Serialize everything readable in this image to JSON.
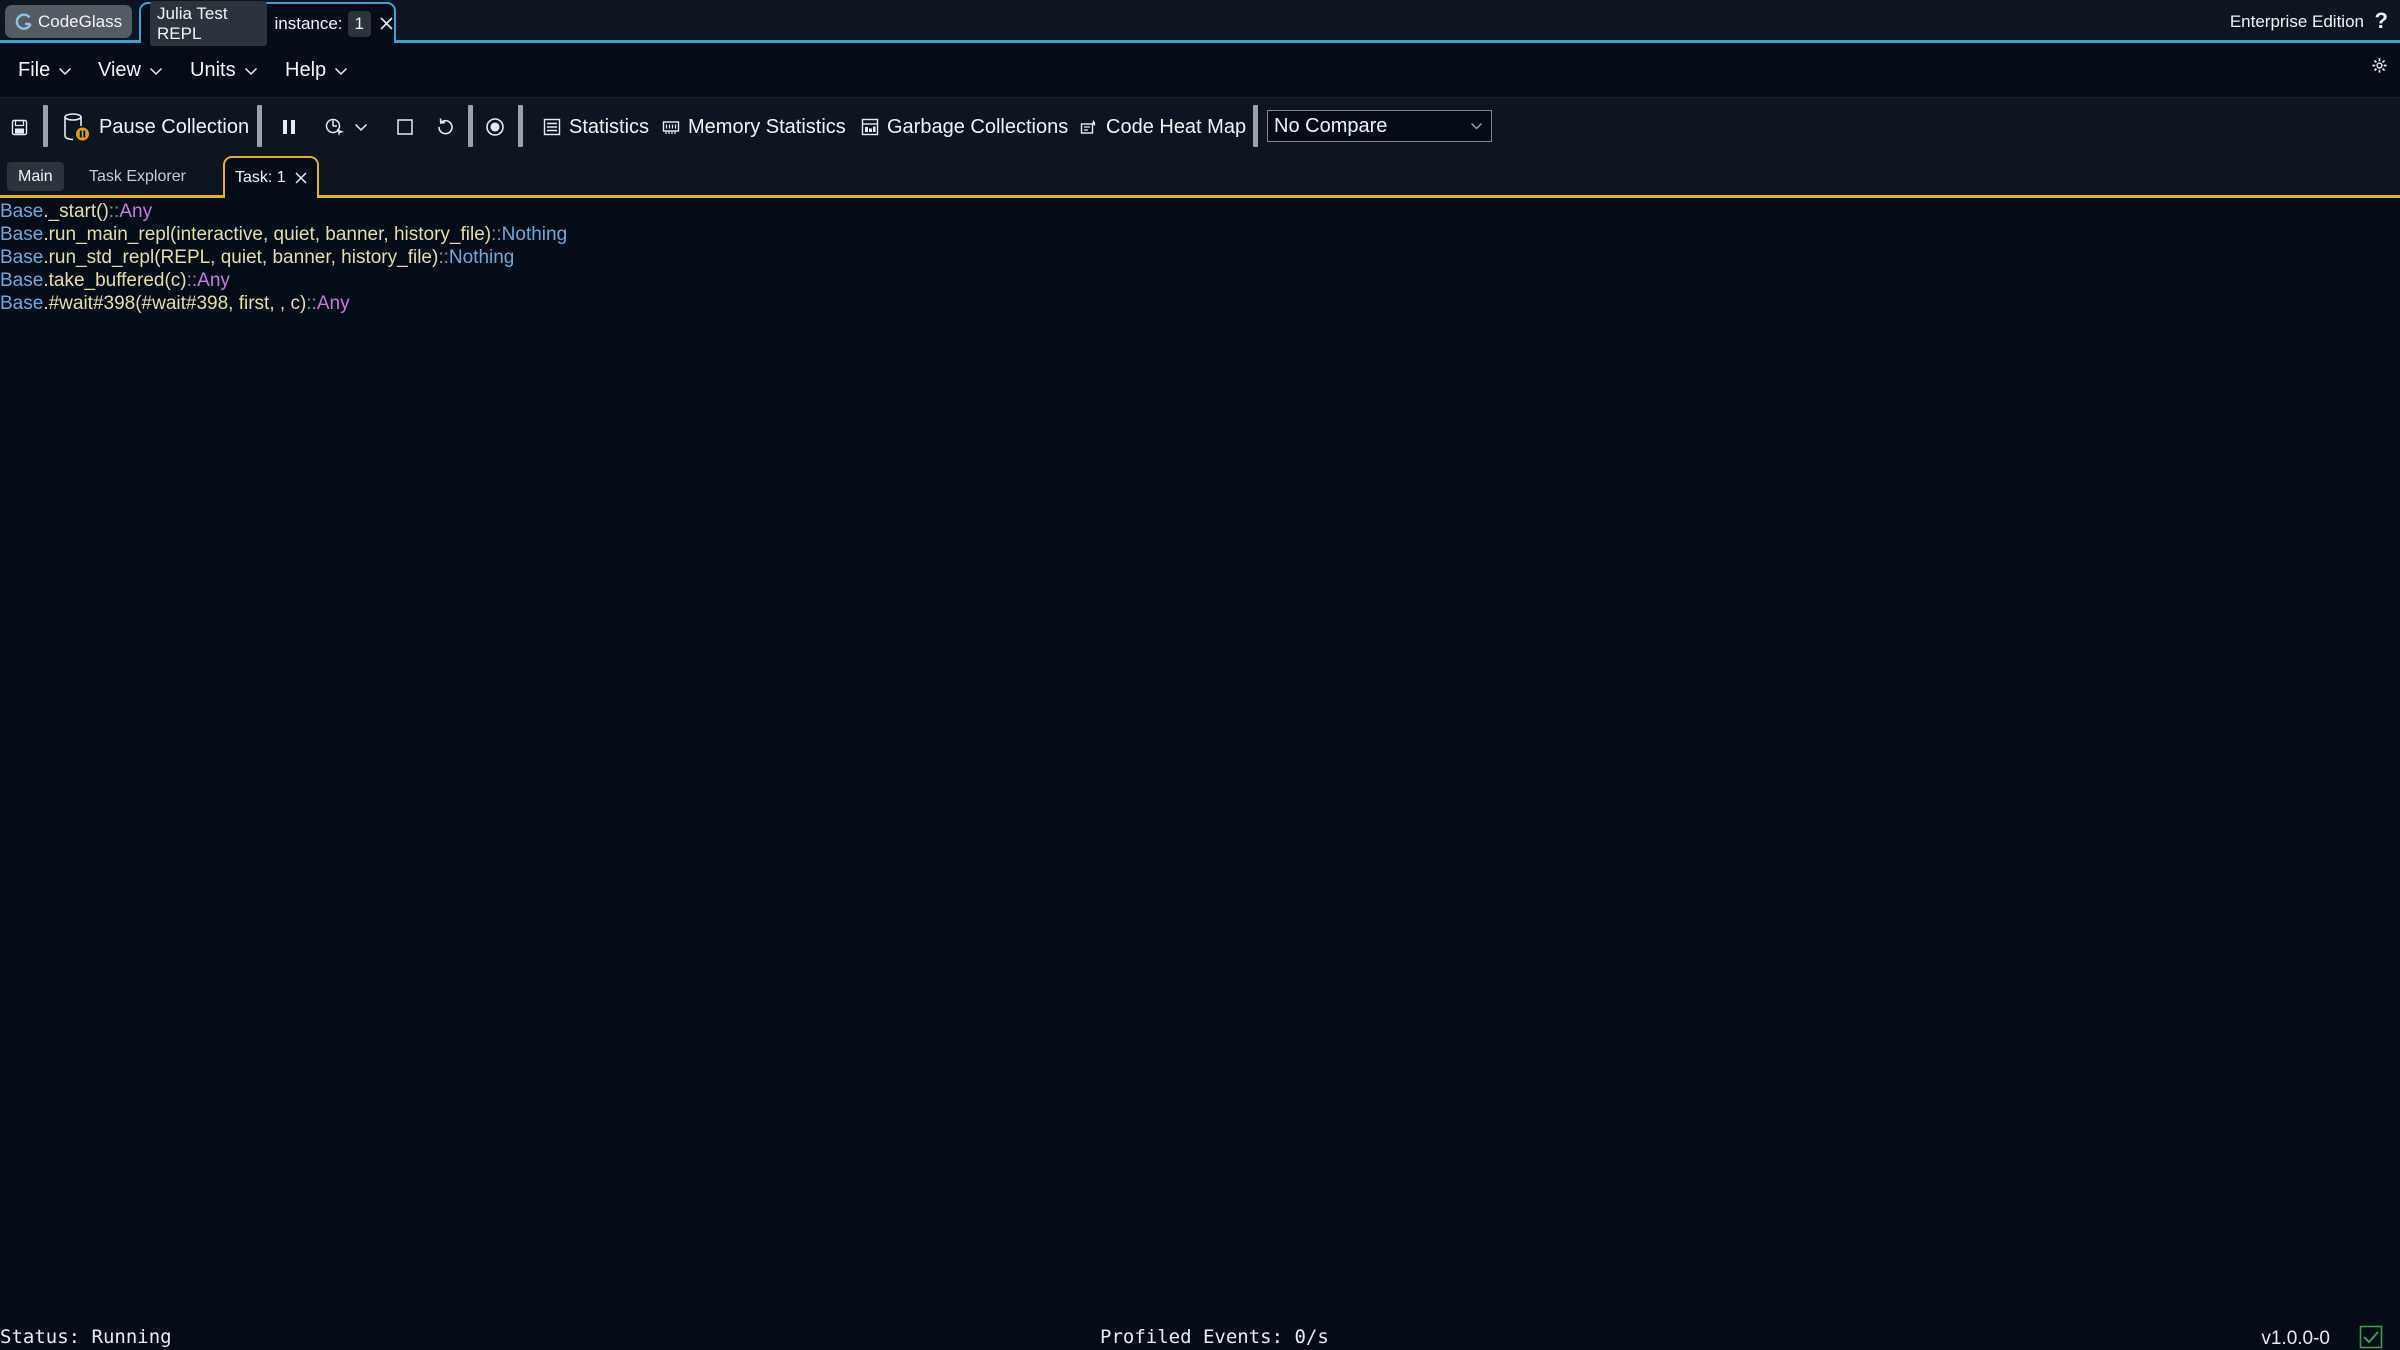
{
  "titlebar": {
    "app_name": "CodeGlass",
    "instance_tab": {
      "name": "Julia Test REPL",
      "label": "instance:",
      "number": "1"
    },
    "edition": "Enterprise Edition",
    "help": "?"
  },
  "menu": {
    "items": [
      {
        "label": "File"
      },
      {
        "label": "View"
      },
      {
        "label": "Units"
      },
      {
        "label": "Help"
      }
    ]
  },
  "toolbar": {
    "pause_collection": "Pause Collection",
    "statistics": "Statistics",
    "memory_statistics": "Memory Statistics",
    "garbage_collections": "Garbage Collections",
    "code_heat_map": "Code Heat Map",
    "compare_select": "No Compare"
  },
  "tabs": {
    "main": "Main",
    "task_explorer": "Task Explorer",
    "task_active": "Task: 1"
  },
  "code_lines": [
    {
      "module": "Base",
      "call": "_start()",
      "sep": "::",
      "ret": "Any"
    },
    {
      "module": "Base",
      "call": "run_main_repl(interactive, quiet, banner, history_file)",
      "sep": "::",
      "ret": "Nothing"
    },
    {
      "module": "Base",
      "call": "run_std_repl(REPL, quiet, banner, history_file)",
      "sep": "::",
      "ret": "Nothing"
    },
    {
      "module": "Base",
      "call": "take_buffered(c)",
      "sep": "::",
      "ret": "Any"
    },
    {
      "module": "Base",
      "call": "#wait#398(#wait#398, first, , c)",
      "sep": "::",
      "ret": "Any"
    }
  ],
  "status": {
    "state": "Status: Running",
    "events": "Profiled Events: 0/s",
    "version": "v1.0.0-0"
  },
  "colors": {
    "background": "#030c17",
    "accent_blue": "#3aa0d8",
    "accent_yellow": "#e6b020",
    "type_any": "#c678dd",
    "type_nothing": "#6fa8dc"
  }
}
